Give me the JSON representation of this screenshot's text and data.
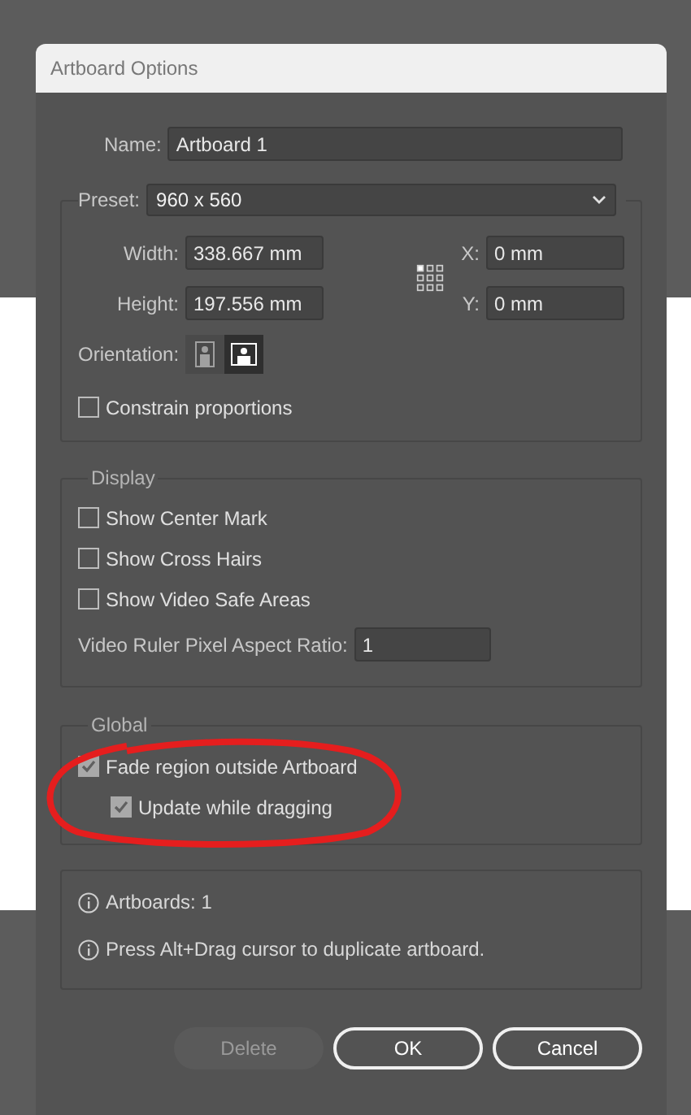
{
  "window": {
    "title": "Artboard Options"
  },
  "name": {
    "label": "Name:",
    "value": "Artboard 1"
  },
  "preset": {
    "label": "Preset:",
    "value": "960 x 560"
  },
  "size_fields": [
    {
      "label": "Width:",
      "value": "338.667 mm"
    },
    {
      "label": "Height:",
      "value": "197.556 mm"
    }
  ],
  "position_fields": [
    {
      "label": "X:",
      "value": "0 mm"
    },
    {
      "label": "Y:",
      "value": "0 mm"
    }
  ],
  "orientation": {
    "label": "Orientation:",
    "options": [
      {
        "kind": "portrait",
        "selected": false
      },
      {
        "kind": "landscape",
        "selected": true
      }
    ]
  },
  "constrain": {
    "label": "Constrain proportions",
    "checked": false
  },
  "display": {
    "title": "Display",
    "options": [
      {
        "label": "Show Center Mark",
        "checked": false
      },
      {
        "label": "Show Cross Hairs",
        "checked": false
      },
      {
        "label": "Show Video Safe Areas",
        "checked": false
      }
    ],
    "ratio": {
      "label": "Video Ruler Pixel Aspect Ratio:",
      "value": "1"
    }
  },
  "global": {
    "title": "Global",
    "options": [
      {
        "label": "Fade region outside Artboard",
        "checked": true,
        "children": [
          {
            "label": "Update while dragging",
            "checked": true
          }
        ]
      }
    ]
  },
  "info": [
    "Artboards: 1",
    "Press Alt+Drag cursor to duplicate artboard."
  ],
  "buttons": [
    {
      "label": "Delete",
      "disabled": true
    },
    {
      "label": "OK",
      "disabled": false
    },
    {
      "label": "Cancel",
      "disabled": false
    }
  ]
}
